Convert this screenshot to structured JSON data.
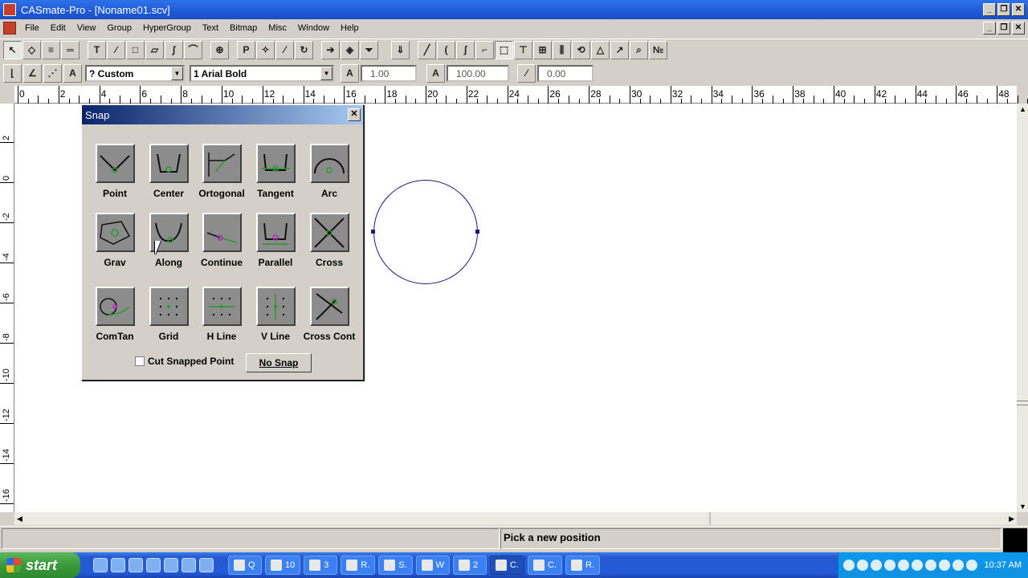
{
  "app": {
    "title": "CASmate-Pro - [Noname01.scv]"
  },
  "window_controls": {
    "minimize": "_",
    "maximize": "❐",
    "close": "✕"
  },
  "menu": [
    "File",
    "Edit",
    "View",
    "Group",
    "HyperGroup",
    "Text",
    "Bitmap",
    "Misc",
    "Window",
    "Help"
  ],
  "toolbar1": {
    "group1": [
      "arrow-pointer-icon",
      "node-edit-icon",
      "weld-icon",
      "break-icon"
    ],
    "group2": [
      "text-tool-icon",
      "pen-icon",
      "rectangle-icon",
      "polygon-icon",
      "curve-icon",
      "arc-tool-icon"
    ],
    "group3": [
      "zoom-icon"
    ],
    "group4": [
      "p-tool-icon",
      "transform-icon",
      "line-tool-icon",
      "rotate-icon"
    ],
    "group5": [
      "arrow-right-icon",
      "layers-icon",
      "funnel-icon"
    ],
    "group6": [
      "knife-icon",
      "line-icon",
      "arc-icon",
      "bezier-icon",
      "corner-icon",
      "select-nodes-icon",
      "align-text-icon",
      "align-center-icon",
      "distribute-icon",
      "rotate-box-icon",
      "mirror-icon",
      "arrow-up-icon",
      "magnifier-icon",
      "numbers-icon"
    ]
  },
  "toolbar2": {
    "mode_buttons": [
      "corner-snap-icon",
      "angle-snap-icon",
      "path-snap-icon",
      "text-fit-icon"
    ],
    "style_combo": "? Custom",
    "font_combo": "1 Arial Bold",
    "field1_value": "1.00",
    "field2_value": "100.00",
    "field3_value": "0.00"
  },
  "ruler": {
    "top_labels": [
      "0",
      "2",
      "4",
      "6",
      "8",
      "10",
      "12",
      "14",
      "16",
      "18",
      "20",
      "22",
      "24",
      "26",
      "28",
      "30",
      "32",
      "34",
      "36",
      "38",
      "40",
      "42",
      "44",
      "46",
      "48"
    ],
    "left_labels": [
      "2",
      "0",
      "-2",
      "-4",
      "-6",
      "-8",
      "-10",
      "-12",
      "-14",
      "-16"
    ]
  },
  "snap_dialog": {
    "title": "Snap",
    "close": "✕",
    "items": [
      {
        "label": "Point",
        "icon": "snap-point-icon"
      },
      {
        "label": "Center",
        "icon": "snap-center-icon"
      },
      {
        "label": "Ortogonal",
        "icon": "snap-ortogonal-icon"
      },
      {
        "label": "Tangent",
        "icon": "snap-tangent-icon"
      },
      {
        "label": "Arc",
        "icon": "snap-arc-icon"
      },
      {
        "label": "Grav",
        "icon": "snap-grav-icon"
      },
      {
        "label": "Along",
        "icon": "snap-along-icon"
      },
      {
        "label": "Continue",
        "icon": "snap-continue-icon"
      },
      {
        "label": "Parallel",
        "icon": "snap-parallel-icon"
      },
      {
        "label": "Cross",
        "icon": "snap-cross-icon"
      },
      {
        "label": "ComTan",
        "icon": "snap-comtan-icon"
      },
      {
        "label": "Grid",
        "icon": "snap-grid-icon"
      },
      {
        "label": "H Line",
        "icon": "snap-hline-icon"
      },
      {
        "label": "V Line",
        "icon": "snap-vline-icon"
      },
      {
        "label": "Cross Cont",
        "icon": "snap-crosscont-icon"
      }
    ],
    "cut_snapped_point": "Cut Snapped Point",
    "no_snap": "No Snap"
  },
  "status": {
    "message": "Pick a new position"
  },
  "taskbar": {
    "start": "start",
    "quick_launch": [
      "ie-icon",
      "ie2-icon",
      "desktop-icon",
      "word-icon",
      "explorer-icon",
      "media-icon",
      "app-icon"
    ],
    "tasks": [
      {
        "label": "Q",
        "icon": "ie-task-icon",
        "active": false
      },
      {
        "label": "10",
        "icon": "folder-task-icon",
        "active": false
      },
      {
        "label": "3",
        "icon": "folder-group-icon",
        "active": false
      },
      {
        "label": "R.",
        "icon": "word-task-icon",
        "active": false
      },
      {
        "label": "S.",
        "icon": "skype-task-icon",
        "active": false
      },
      {
        "label": "W",
        "icon": "word2-task-icon",
        "active": false
      },
      {
        "label": "2",
        "icon": "casmate-group-icon",
        "active": false
      },
      {
        "label": "C.",
        "icon": "casmate-task-icon",
        "active": true
      },
      {
        "label": "C.",
        "icon": "cad-task-icon",
        "active": false
      },
      {
        "label": "R.",
        "icon": "r-task-icon",
        "active": false
      }
    ],
    "clock": "10:37 AM"
  }
}
